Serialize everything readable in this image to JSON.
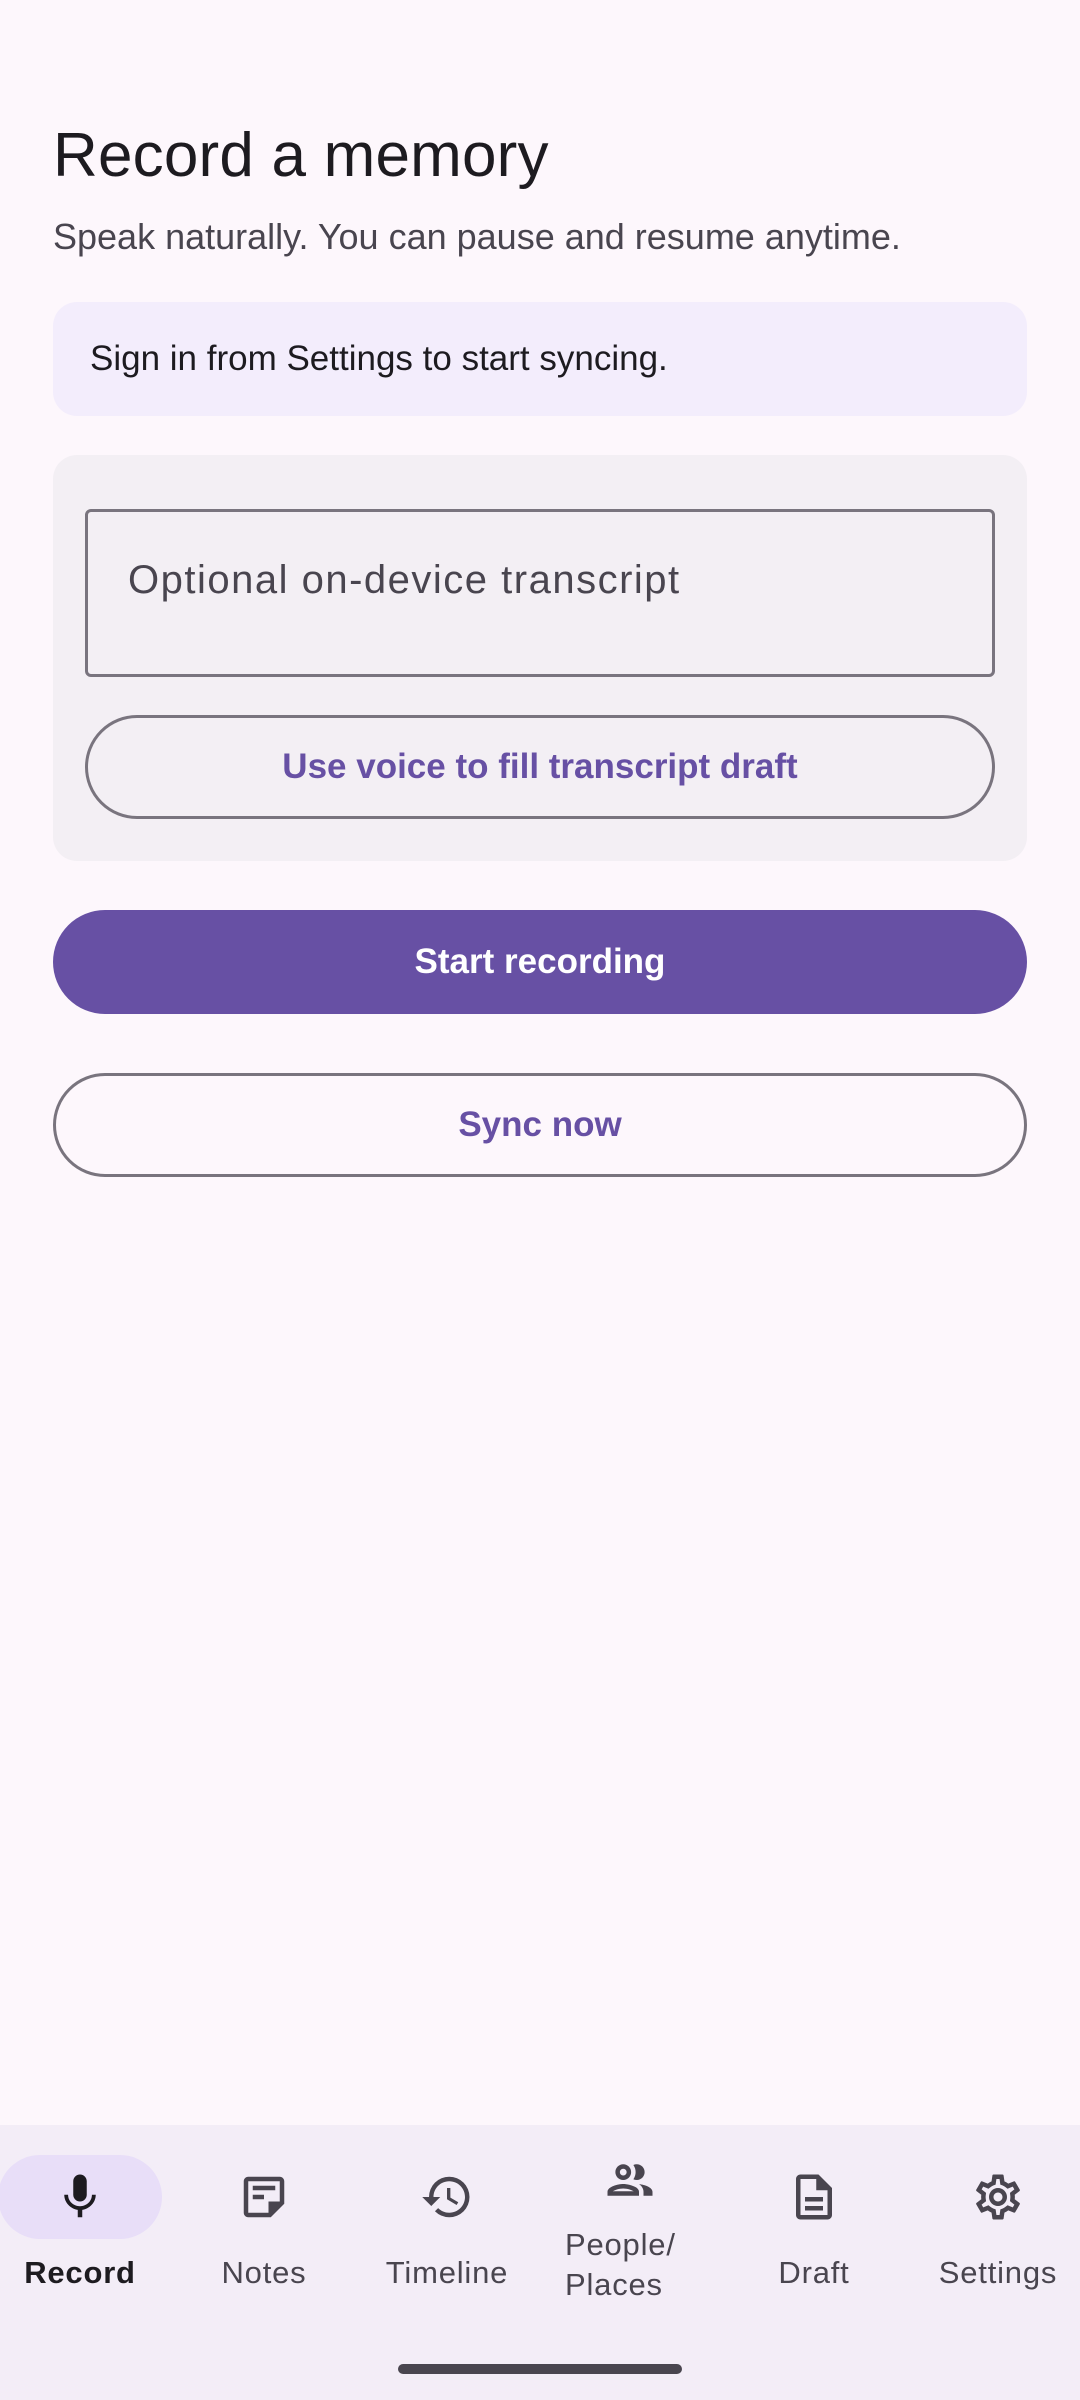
{
  "header": {
    "title": "Record a memory",
    "subtitle": "Speak naturally. You can pause and resume anytime."
  },
  "banner": {
    "text": "Sign in from Settings to start syncing."
  },
  "transcript": {
    "placeholder": "Optional on-device transcript",
    "value": "",
    "voice_button_label": "Use voice to fill transcript draft"
  },
  "actions": {
    "start_label": "Start recording",
    "sync_label": "Sync now"
  },
  "nav": {
    "active": "Record",
    "items": [
      {
        "label": "Record",
        "icon": "mic-icon"
      },
      {
        "label": "Notes",
        "icon": "notes-icon"
      },
      {
        "label": "Timeline",
        "icon": "history-icon"
      },
      {
        "label": "People/\nPlaces",
        "icon": "people-icon"
      },
      {
        "label": "Draft",
        "icon": "document-icon"
      },
      {
        "label": "Settings",
        "icon": "gear-icon"
      }
    ]
  },
  "colors": {
    "primary": "#6750a4",
    "background": "#fdf7fc",
    "banner": "#f3edfc",
    "card": "#f3eff4",
    "nav_background": "#f3edf7",
    "nav_active_pill": "#e8def8"
  }
}
